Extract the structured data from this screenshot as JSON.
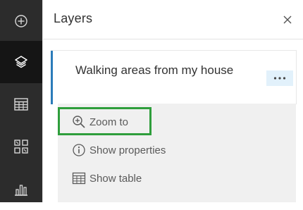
{
  "toolbar": {
    "buttons": [
      {
        "icon": "add-icon"
      },
      {
        "icon": "layers-icon",
        "active": true
      },
      {
        "icon": "table-icon"
      },
      {
        "icon": "layout-grid-icon"
      },
      {
        "icon": "bar-chart-icon"
      }
    ]
  },
  "panel": {
    "title": "Layers",
    "close_icon": "close-icon"
  },
  "layer": {
    "name": "Walking areas from my house",
    "more_icon": "more-options-icon",
    "accent_color": "#2b7bb9"
  },
  "menu": {
    "items": [
      {
        "label": "Zoom to",
        "icon": "zoom-in-icon",
        "highlighted": true
      },
      {
        "label": "Show properties",
        "icon": "info-icon"
      },
      {
        "label": "Show table",
        "icon": "table-icon"
      }
    ],
    "highlight_color": "#2f9e3c"
  }
}
